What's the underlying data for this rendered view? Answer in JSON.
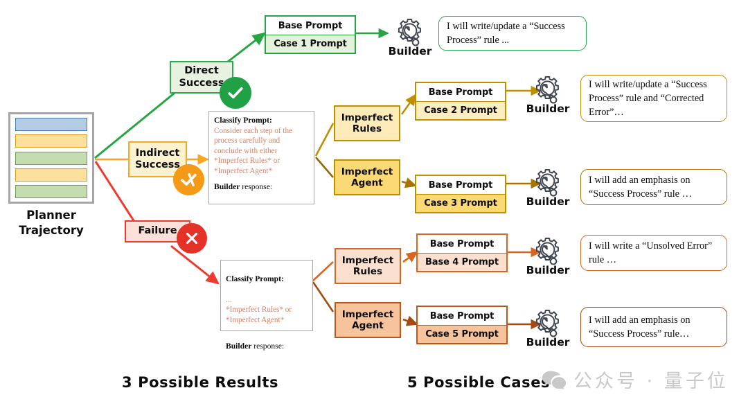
{
  "figure": {
    "planner": {
      "label": "Planner\nTrajectory",
      "label_line1": "Planner",
      "label_line2": "Trajectory",
      "bars": [
        {
          "name": "step-1",
          "fill": "#b4cde4",
          "stroke": "#4a7bab"
        },
        {
          "name": "step-2",
          "fill": "#fce19c",
          "stroke": "#d99c10"
        },
        {
          "name": "step-3",
          "fill": "#c3ddb0",
          "stroke": "#6d9e52"
        },
        {
          "name": "step-4",
          "fill": "#fce19c",
          "stroke": "#d99c10"
        },
        {
          "name": "step-5",
          "fill": "#c3ddb0",
          "stroke": "#6d9e52"
        }
      ],
      "frame_color": "#a6a6a6"
    },
    "results": [
      {
        "id": "direct-success",
        "label_line1": "Direct",
        "label_line2": "Success",
        "fill": "#e7f2e0",
        "stroke": "#2eab50",
        "badge": "check-icon",
        "badge_color": "#21a146"
      },
      {
        "id": "indirect-success",
        "label_line1": "Indirect",
        "label_line2": "Success",
        "fill": "#fdf2cf",
        "stroke": "#f7a723",
        "badge": "check-cross-icon",
        "badge_color": "#f49a17"
      },
      {
        "id": "failure",
        "label_line1": "Failure",
        "label_line2": "",
        "fill": "#fbe0d9",
        "stroke": "#ee3b2e",
        "badge": "cross-icon",
        "badge_color": "#e53229"
      }
    ],
    "classify_prompts": [
      {
        "id": "classify-indirect",
        "header": "Classify Prompt:",
        "body": "Consider each step of the process carefully and conclude with either *Imperfect Rules* or *Imperfect Agent*",
        "response_label": "Builder",
        "response_suffix": " response:"
      },
      {
        "id": "classify-failure",
        "header": "Classify Prompt:",
        "body": "...\n*Imperfect Rules* or\n*Imperfect Agent*",
        "response_label": "Builder",
        "response_suffix": " response:"
      }
    ],
    "branches": [
      {
        "id": "indirect-imperfect-rules",
        "label_line1": "Imperfect",
        "label_line2": "Rules",
        "fill": "#fdecba",
        "stroke": "#bf8f00"
      },
      {
        "id": "indirect-imperfect-agent",
        "label_line1": "Imperfect",
        "label_line2": "Agent",
        "fill": "#fbd975",
        "stroke": "#bf8f00"
      },
      {
        "id": "failure-imperfect-rules",
        "label_line1": "Imperfect",
        "label_line2": "Rules",
        "fill": "#fbe0d0",
        "stroke": "#d9661f"
      },
      {
        "id": "failure-imperfect-agent",
        "label_line1": "Imperfect",
        "label_line2": "Agent",
        "fill": "#f5c39c",
        "stroke": "#c05515"
      }
    ],
    "cases": [
      {
        "id": "case-1",
        "base_label": "Base Prompt",
        "case_label": "Case 1 Prompt",
        "stroke": "#27a544",
        "case_fill": "#e4f1db",
        "builder_label": "Builder",
        "builder_icon": "gear-wrench-icon",
        "arrow_color": "#27a544",
        "bubble_text": "I will write/update a “Success Process” rule ...",
        "bubble_stroke": "#1faa4f"
      },
      {
        "id": "case-2",
        "base_label": "Base Prompt",
        "case_label": "Case 2 Prompt",
        "stroke": "#bf8f00",
        "case_fill": "#fdeec0",
        "builder_label": "Builder",
        "builder_icon": "gear-wrench-icon",
        "arrow_color": "#bf8f00",
        "bubble_text": "I will write/update a “Success Process” rule and “Corrected Error”…",
        "bubble_stroke": "#bf8f00"
      },
      {
        "id": "case-3",
        "base_label": "Base Prompt",
        "case_label": "Case 3 Prompt",
        "stroke": "#bf8f00",
        "case_fill": "#fbd975",
        "builder_label": "Builder",
        "builder_icon": "gear-wrench-icon",
        "arrow_color": "#a87400",
        "bubble_text": "I will add an emphasis on “Success Process” rule …",
        "bubble_stroke": "#a87400"
      },
      {
        "id": "case-4",
        "base_label": "Base Prompt",
        "case_label": "Base 4 Prompt",
        "stroke": "#d9661f",
        "case_fill": "#fbe0d0",
        "builder_label": "Builder",
        "builder_icon": "gear-wrench-icon",
        "arrow_color": "#d9661f",
        "bubble_text": "I will write a “Unsolved Error” rule …",
        "bubble_stroke": "#d9661f"
      },
      {
        "id": "case-5",
        "base_label": "Base Prompt",
        "case_label": "Case 5 Prompt",
        "stroke": "#c05515",
        "case_fill": "#f5c39c",
        "builder_label": "Builder",
        "builder_icon": "gear-wrench-icon",
        "arrow_color": "#a8490f",
        "bubble_text": "I will add an emphasis on “Success Process” rule…",
        "bubble_stroke": "#a8490f"
      }
    ],
    "footer": {
      "left_caption": "3 Possible Results",
      "right_caption": "5 Possible Cases"
    },
    "watermark": {
      "icon": "wechat-icon",
      "text": "公众号 · 量子位",
      "color": "#c9c9c9"
    },
    "colors": {
      "green": "#27a544",
      "gold": "#bf8f00",
      "orange_yellow": "#f7a723",
      "red": "#ee3b2e",
      "orange": "#d9661f",
      "dark_orange": "#a8490f",
      "gray_frame": "#a6a6a6"
    }
  }
}
